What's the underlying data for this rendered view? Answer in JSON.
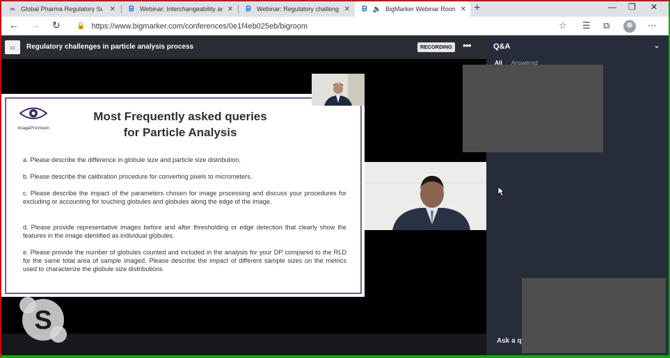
{
  "tabs": [
    {
      "title": "Global Pharma Regulatory Summ",
      "icon": "pharma-logo-icon"
    },
    {
      "title": "Webinar: Interchangeability and",
      "icon": "bigmarker-icon"
    },
    {
      "title": "Webinar: Regulatory challenges",
      "icon": "bigmarker-icon"
    },
    {
      "title": "BigMarker Webinar Room",
      "icon": "bigmarker-icon",
      "active": true
    }
  ],
  "browser": {
    "url": "https://www.bigmarker.com/conferences/0e1f4eb025eb/bigroom"
  },
  "room": {
    "title": "Regulatory challenges in particle analysis process",
    "recording_label": "RECORDING",
    "more_label": "•••"
  },
  "slide": {
    "logo_text": "ImageProVision",
    "title_line1": "Most Frequently asked queries",
    "title_line2": "for Particle Analysis",
    "questions": [
      "a. Please describe the difference in globule size and particle size distribution.",
      "b. Please describe the calibration procedure for converting pixels to micrometers.",
      "c. Please describe the impact of the parameters chosen for image processing and discuss your procedures for excluding or accounting for touching globules and globules along the edge of the image.",
      "d. Please provide representative images before and after thresholding or edge detection that clearly show the features in the image identified as individual globules.",
      "e. Please provide the number of globules counted and included in the analysis for your DP compared to the RLD for the same total area of sample imaged. Please describe the impact of different sample sizes on the metrics used to characterize the globule size distributions"
    ]
  },
  "qa": {
    "title": "Q&A",
    "tab_all": "All",
    "tab_answered": "Answered",
    "ask_placeholder": "Ask a qu"
  },
  "colors": {
    "slide_border": "#7a5a8a",
    "panel_bg": "#262c3a",
    "header_bg": "#2a2d33",
    "frame_left": "#d40000",
    "frame_right": "#1aa31a"
  }
}
